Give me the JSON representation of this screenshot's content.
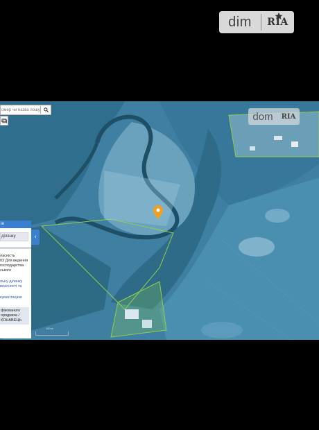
{
  "watermark": {
    "brand_dim": "dim",
    "brand_ria": "RIA"
  },
  "map": {
    "watermark": {
      "brand_dim": "dom",
      "brand_ria": "RIA"
    },
    "search": {
      "placeholder": "омер чи назва пошуку"
    },
    "marker_color": "#f0a020",
    "panel": {
      "header": "ія",
      "tab_label": "ділянку",
      "details": "ласність\n03 Для ведення\nгосподарства\nського",
      "link_1": "льну ділянку\nвласності та",
      "link_2": "кументацією",
      "box_text": "фікованого\nорядника /\nКОНАВЕЦЬ"
    },
    "scale_label": "100 м"
  },
  "colors": {
    "accent": "#3b7fd0",
    "map_water": "#3f80a2",
    "parcel_outline": "#8fd14a"
  }
}
